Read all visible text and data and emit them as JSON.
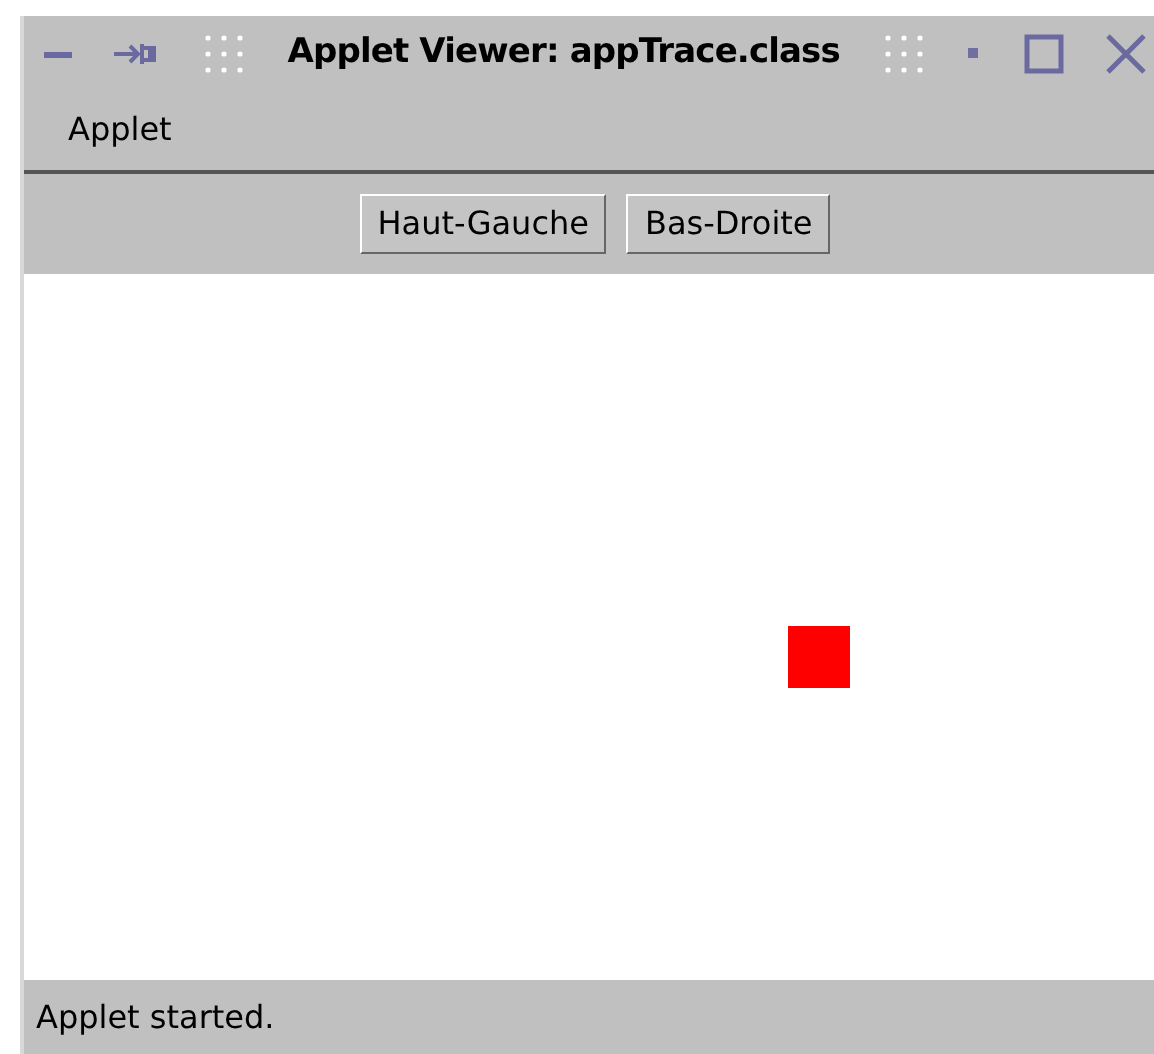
{
  "window": {
    "title": "Applet Viewer: appTrace.class"
  },
  "menu": [
    "Applet"
  ],
  "buttons": [
    "Haut-Gauche",
    "Bas-Droite"
  ],
  "status_bar": "Applet started."
}
